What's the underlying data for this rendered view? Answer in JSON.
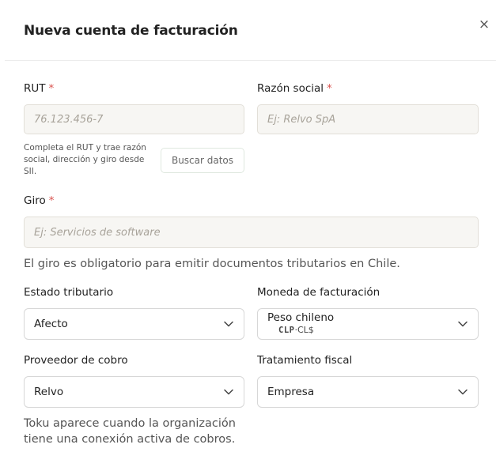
{
  "dialog": {
    "title": "Nueva cuenta de facturación",
    "close_symbol": "×"
  },
  "required_marker": "*",
  "fields": {
    "rut": {
      "label": "RUT",
      "placeholder": "76.123.456-7"
    },
    "razon": {
      "label": "Razón social",
      "placeholder": "Ej: Relvo SpA"
    },
    "rut_help": "Completa el RUT y trae razón social, dirección y giro desde SII.",
    "buscar_button": "Buscar datos",
    "giro": {
      "label": "Giro",
      "placeholder": "Ej: Servicios de software"
    },
    "giro_help": "El giro es obligatorio para emitir documentos tributarios en Chile.",
    "estado": {
      "label": "Estado tributario",
      "value": "Afecto"
    },
    "moneda": {
      "label": "Moneda de facturación",
      "value": "Peso chileno",
      "code": "CLP",
      "separator": "·",
      "symbol": "CL$"
    },
    "proveedor": {
      "label": "Proveedor de cobro",
      "value": "Relvo"
    },
    "tratamiento": {
      "label": "Tratamiento fiscal",
      "value": "Empresa"
    },
    "proveedor_help": "Toku aparece cuando la organización tiene una conexión activa de cobros."
  },
  "icons": {
    "close": "close-icon",
    "chevron": "chevron-down-icon"
  }
}
